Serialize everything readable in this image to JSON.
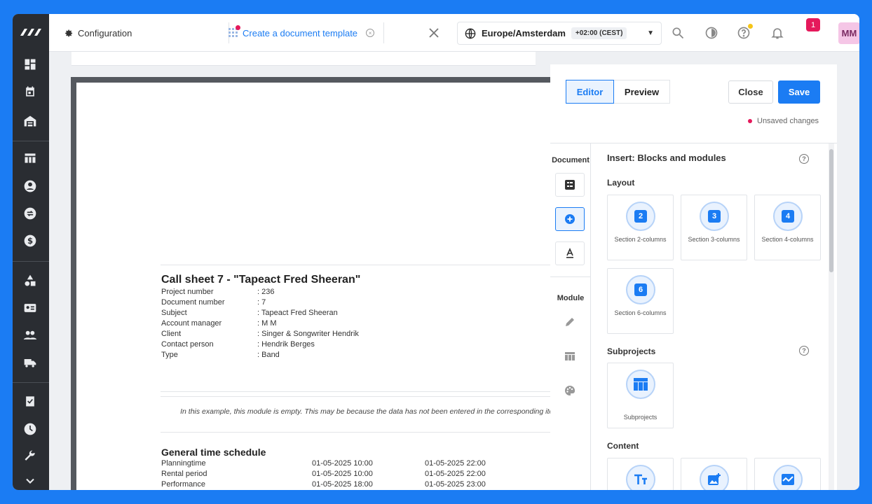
{
  "topbar": {
    "config_label": "Configuration",
    "doc_tab_label": "Create a document template",
    "timezone_name": "Europe/Amsterdam",
    "timezone_offset": "+02:00 (CEST)",
    "notification_count": "1",
    "avatar_initials": "MM",
    "user_name": "M M"
  },
  "document": {
    "title": "Call sheet 7 - \"Tapeact Fred Sheeran\"",
    "fields": [
      {
        "label": "Project number",
        "value": ": 236"
      },
      {
        "label": "Document number",
        "value": ": 7"
      },
      {
        "label": "Subject",
        "value": ": Tapeact Fred Sheeran"
      },
      {
        "label": "Account manager",
        "value": ": M M"
      },
      {
        "label": "Client",
        "value": ": Singer & Songwriter Hendrik"
      },
      {
        "label": "Contact person",
        "value": ": Hendrik Berges"
      },
      {
        "label": "Type",
        "value": ": Band"
      }
    ],
    "empty_note": "In this example, this module is empty. This may be because the data has not been entered in the corresponding item.",
    "schedule_title": "General time schedule",
    "schedule": [
      {
        "name": "Planningtime",
        "start": "01-05-2025 10:00",
        "end": "01-05-2025 22:00"
      },
      {
        "name": "Rental period",
        "start": "01-05-2025 10:00",
        "end": "01-05-2025 22:00"
      },
      {
        "name": "Performance",
        "start": "01-05-2025 18:00",
        "end": "01-05-2025 23:00"
      }
    ]
  },
  "panel": {
    "editor_label": "Editor",
    "preview_label": "Preview",
    "close_label": "Close",
    "save_label": "Save",
    "unsaved_label": "Unsaved changes",
    "rail_document_label": "Document",
    "rail_module_label": "Module",
    "blocks_title": "Insert: Blocks and modules",
    "layout_title": "Layout",
    "layout_cards": [
      {
        "num": "2",
        "caption": "Section 2-columns"
      },
      {
        "num": "3",
        "caption": "Section 3-columns"
      },
      {
        "num": "4",
        "caption": "Section 4-columns"
      },
      {
        "num": "6",
        "caption": "Section 6-columns"
      }
    ],
    "subprojects_title": "Subprojects",
    "subprojects_card": "Subprojects",
    "content_title": "Content"
  },
  "colors": {
    "accent": "#1b7cf3",
    "alert": "#e5195b",
    "sidebar": "#2a2d32"
  }
}
